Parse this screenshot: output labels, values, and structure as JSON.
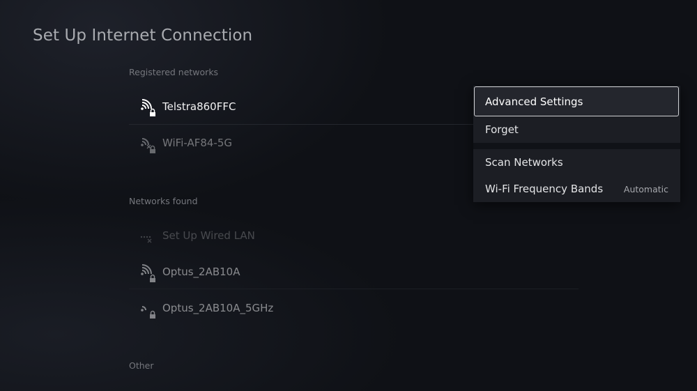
{
  "header": {
    "title": "Set Up Internet Connection"
  },
  "sections": {
    "registered": {
      "label": "Registered networks",
      "networks": [
        {
          "name": "Telstra860FFC",
          "icon": "wifi-signal-icon",
          "locked": true
        },
        {
          "name": "WiFi-AF84-5G",
          "icon": "wifi-unavailable-icon",
          "locked": true
        }
      ]
    },
    "found": {
      "label": "Networks found",
      "networks": [
        {
          "name": "Set Up Wired LAN",
          "icon": "wired-lan-disconnected-icon",
          "locked": false
        },
        {
          "name": "Optus_2AB10A",
          "icon": "wifi-signal-icon",
          "locked": true
        },
        {
          "name": "Optus_2AB10A_5GHz",
          "icon": "wifi-weak-signal-icon",
          "locked": true
        }
      ]
    },
    "other": {
      "label": "Other"
    }
  },
  "options_menu": {
    "items": [
      {
        "label": "Advanced Settings",
        "focused": true
      },
      {
        "label": "Forget"
      }
    ],
    "items2": [
      {
        "label": "Scan Networks"
      },
      {
        "label": "Wi-Fi Frequency Bands",
        "value": "Automatic"
      }
    ]
  },
  "colors": {
    "background": "#0f1116",
    "menu_background": "#1c1e24",
    "focus_border": "#cfd0d3",
    "text_primary": "#e8e8ea",
    "text_dim": "#75777d"
  }
}
